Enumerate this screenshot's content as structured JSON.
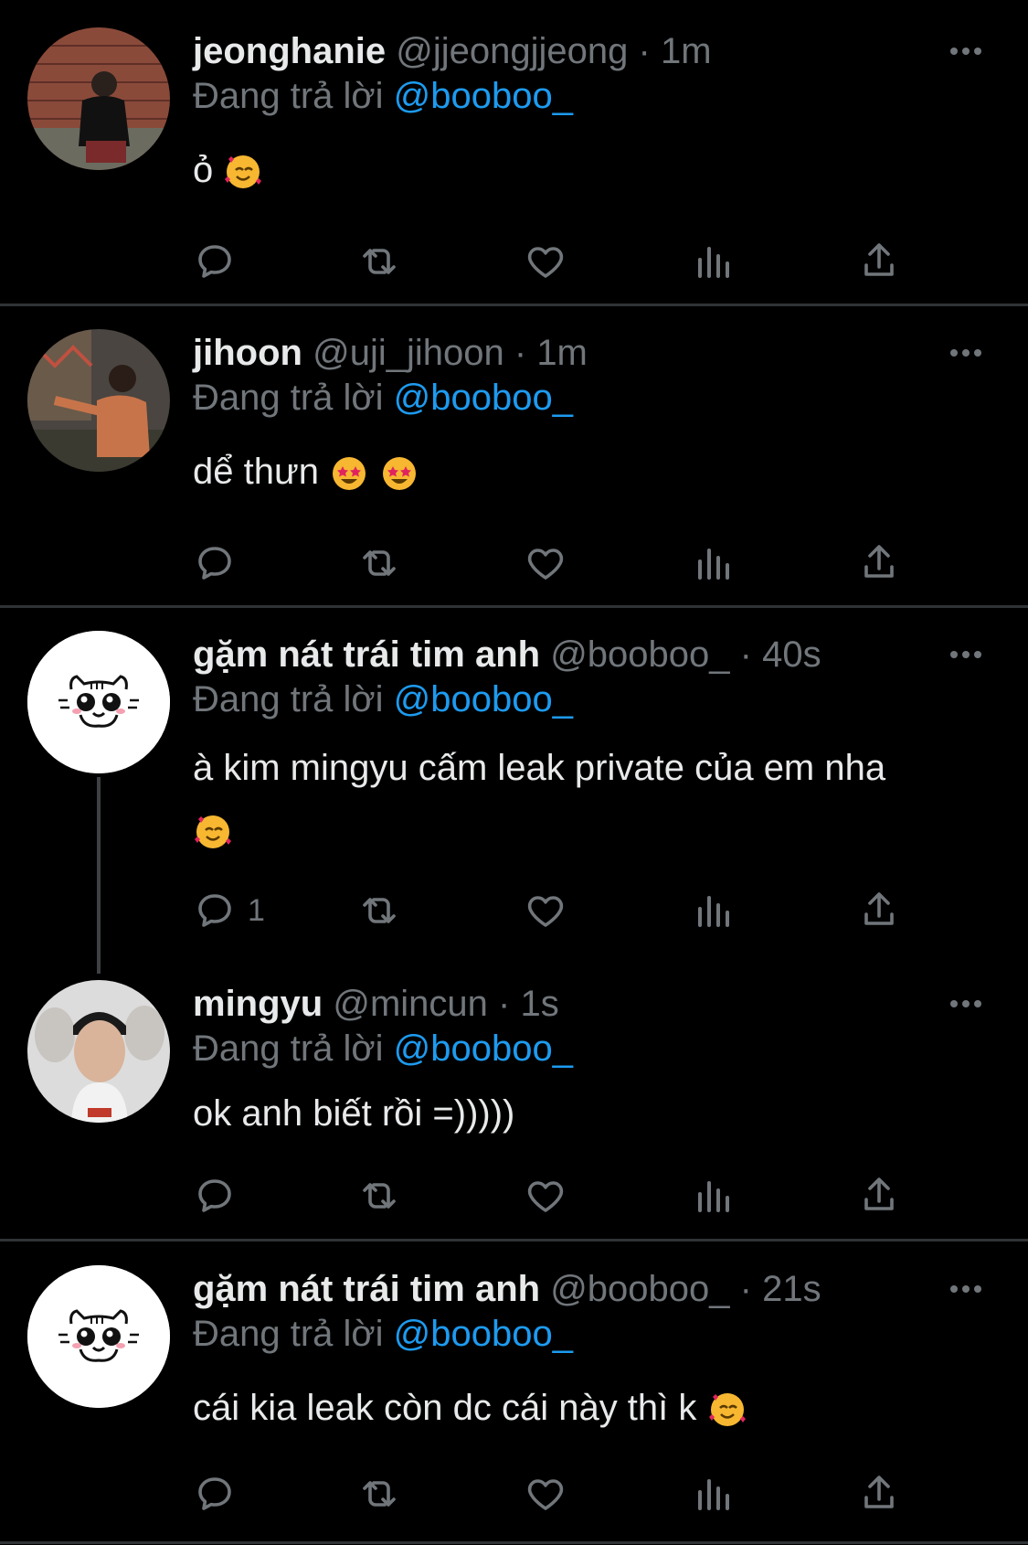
{
  "common": {
    "reply_prefix": "Đang trả lời",
    "dot": "·"
  },
  "tweets": [
    {
      "name": "jeonghanie",
      "handle": "@jjeongjjeong",
      "time": "1m",
      "reply_to": "@booboo_",
      "text": "ỏ",
      "emojis": [
        "smiling-face-with-hearts"
      ],
      "reply_count": "",
      "avatar": "photo"
    },
    {
      "name": "jihoon",
      "handle": "@uji_jihoon",
      "time": "1m",
      "reply_to": "@booboo_",
      "text": "dể thưn",
      "emojis": [
        "star-struck",
        "star-struck"
      ],
      "reply_count": "",
      "avatar": "photo"
    },
    {
      "name": "gặm nát trái tim anh",
      "handle": "@booboo_",
      "time": "40s",
      "reply_to": "@booboo_",
      "text": "à kim mingyu cấm leak private của em nha",
      "emojis": [
        "smiling-face-with-hearts"
      ],
      "reply_count": "1",
      "avatar": "cat-drawing"
    },
    {
      "name": "mingyu",
      "handle": "@mincun",
      "time": "1s",
      "reply_to": "@booboo_",
      "text": "ok anh biết rồi =)))))",
      "emojis": [],
      "reply_count": "",
      "avatar": "photo"
    },
    {
      "name": "gặm nát trái tim anh",
      "handle": "@booboo_",
      "time": "21s",
      "reply_to": "@booboo_",
      "text": "cái kia leak còn dc cái này thì k",
      "emojis": [
        "smiling-face-with-hearts"
      ],
      "reply_count": "",
      "avatar": "cat-drawing"
    }
  ],
  "colors": {
    "background": "#000000",
    "secondary_text": "#71767b",
    "mention": "#1d9bf0",
    "divider": "#2f3336",
    "primary_text": "#e7e9ea"
  },
  "icons": [
    "reply-icon",
    "retweet-icon",
    "like-icon",
    "views-icon",
    "share-icon",
    "more-icon"
  ]
}
